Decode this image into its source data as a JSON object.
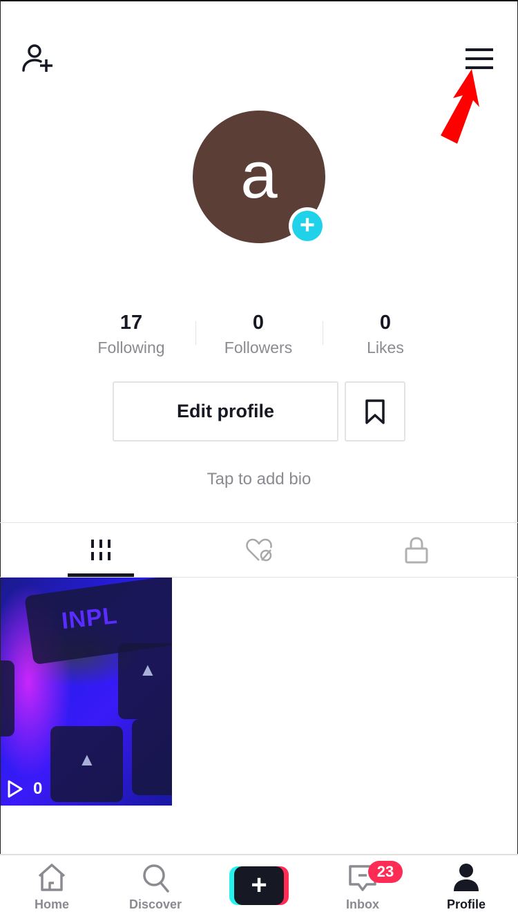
{
  "header": {
    "add_user_icon": "person-plus-icon",
    "menu_icon": "hamburger-menu-icon",
    "annotation": "red-arrow-pointing-to-menu"
  },
  "profile": {
    "avatar_letter": "a",
    "avatar_color": "#5b3f36",
    "avatar_add_icon": "+",
    "stats": [
      {
        "value": "17",
        "label": "Following"
      },
      {
        "value": "0",
        "label": "Followers"
      },
      {
        "value": "0",
        "label": "Likes"
      }
    ],
    "edit_profile_label": "Edit profile",
    "bookmark_icon": "bookmark-icon",
    "bio_placeholder": "Tap to add bio"
  },
  "tabs": [
    {
      "name": "videos",
      "icon": "grid-icon",
      "active": true
    },
    {
      "name": "liked",
      "icon": "heart-hidden-icon",
      "active": false
    },
    {
      "name": "private",
      "icon": "lock-icon",
      "active": false
    }
  ],
  "videos": [
    {
      "thumbnail_text": "INPL",
      "views": "0"
    }
  ],
  "bottom_nav": {
    "items": [
      {
        "label": "Home",
        "icon": "home-icon"
      },
      {
        "label": "Discover",
        "icon": "search-icon"
      },
      {
        "label": "",
        "icon": "create-plus-icon"
      },
      {
        "label": "Inbox",
        "icon": "inbox-icon",
        "badge": "23"
      },
      {
        "label": "Profile",
        "icon": "profile-icon",
        "active": true
      }
    ],
    "create_symbol": "+"
  },
  "colors": {
    "accent_cyan": "#1fd2e9",
    "accent_red": "#fe2c55",
    "text_primary": "#161823",
    "text_secondary": "#8a8b91"
  }
}
